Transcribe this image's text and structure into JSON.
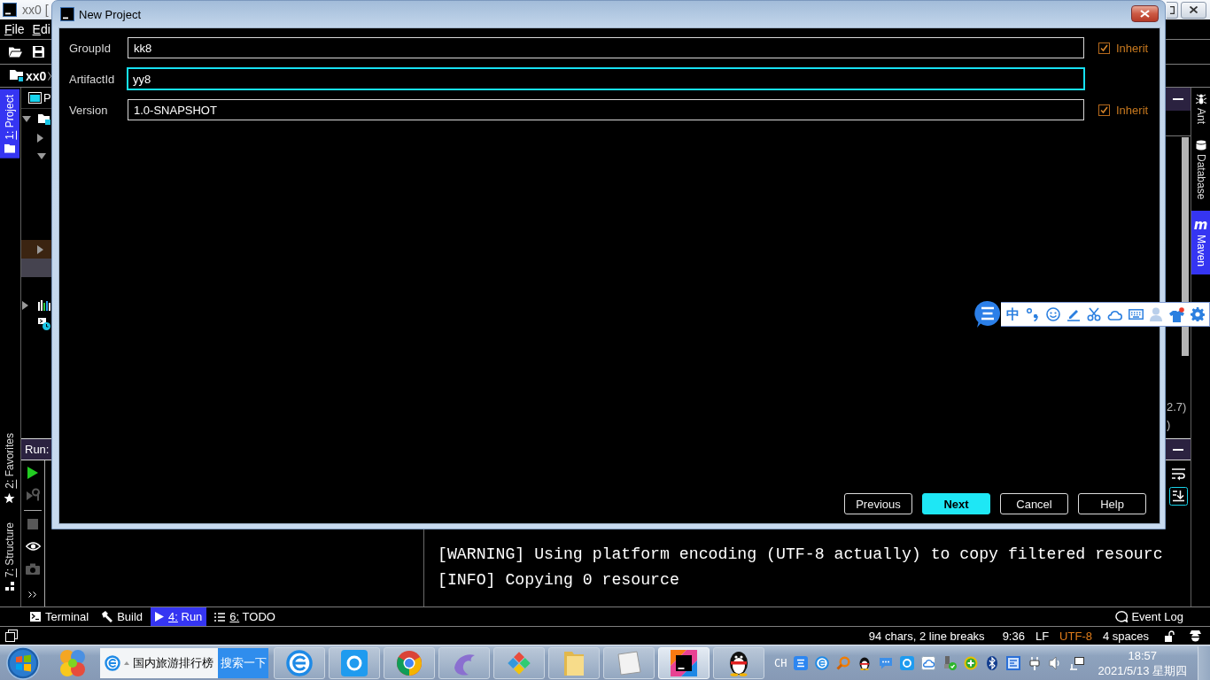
{
  "ide": {
    "title": "xx0 [",
    "menu": [
      {
        "label": "File",
        "mnemonic": true
      },
      {
        "label": "Edi",
        "mnemonic": true
      }
    ],
    "breadcrumb": "xx0",
    "left_tabs": [
      {
        "label": "1: Project",
        "mnemonic": true,
        "selected": true
      },
      {
        "label": "2: Favorites",
        "mnemonic": true,
        "selected": false
      },
      {
        "label": "7: Structure",
        "mnemonic": true,
        "selected": false
      }
    ],
    "project_panel": {
      "title": "P",
      "tree": [
        {
          "kind": "node",
          "expanded": true,
          "selected": false,
          "children": [
            {
              "kind": "node",
              "expanded": false,
              "selected": false
            },
            {
              "kind": "node",
              "expanded": true,
              "selected": false
            },
            {
              "kind": "node",
              "expanded": false,
              "selected": false,
              "color": "#3b2411"
            },
            {
              "kind": "leaf",
              "selected": true
            }
          ]
        },
        {
          "kind": "node",
          "expanded": false,
          "selected": false
        },
        {
          "kind": "leaf",
          "selected": false
        }
      ]
    },
    "run_panel": {
      "title": "Run:",
      "toolbar": [
        {
          "disabled": false
        },
        {
          "disabled": true
        },
        {
          "disabled": true
        },
        {
          "disabled": false
        },
        {
          "disabled": true
        },
        {
          "disabled": false
        }
      ],
      "console": [
        "[WARNING] Using platform encoding (UTF-8 actually) to copy filtered resourc",
        "[INFO] Copying 0 resource"
      ]
    },
    "side_panel_text": [
      "2.7)",
      ")"
    ],
    "right_tabs": [
      {
        "label": "Ant",
        "selected": false
      },
      {
        "label": "Database",
        "selected": false
      },
      {
        "label": "Maven",
        "glyph": "m",
        "selected": true
      }
    ],
    "tool_tabs": [
      {
        "label": "Terminal",
        "mnemonic": false,
        "selected": false
      },
      {
        "label": "Build",
        "mnemonic": false,
        "selected": false
      },
      {
        "label": "4: Run",
        "mnemonic": true,
        "selected": true
      },
      {
        "label": "6: TODO",
        "mnemonic": true,
        "selected": false
      }
    ],
    "event_log": "Event Log",
    "status": [
      {
        "text": "94 chars, 2 line breaks",
        "color": "#ffffff"
      },
      {
        "text": "9:36",
        "color": "#ffffff"
      },
      {
        "text": "LF",
        "color": "#ffffff"
      },
      {
        "text": "UTF-8",
        "color": "#e07c1a"
      },
      {
        "text": "4 spaces",
        "color": "#ffffff"
      }
    ]
  },
  "dialog": {
    "title": "New Project",
    "fields": [
      {
        "label": "GroupId",
        "value": "kk8",
        "focused": false,
        "inherit": {
          "label": "Inherit",
          "checked": true
        }
      },
      {
        "label": "ArtifactId",
        "value": "yy8",
        "focused": true
      },
      {
        "label": "Version",
        "value": "1.0-SNAPSHOT",
        "focused": false,
        "inherit": {
          "label": "Inherit",
          "checked": true
        }
      }
    ],
    "buttons": [
      {
        "label": "Previous",
        "default": false
      },
      {
        "label": "Next",
        "default": true
      },
      {
        "label": "Cancel",
        "default": false
      },
      {
        "label": "Help",
        "default": false
      }
    ]
  },
  "ime_bar": {
    "mode": "中"
  },
  "taskbar": {
    "search": {
      "value": "国内旅游排行榜",
      "button": "搜索一下"
    },
    "apps": [
      {
        "selected": false
      },
      {
        "selected": false
      },
      {
        "selected": false
      },
      {
        "selected": false
      },
      {
        "selected": false
      },
      {
        "selected": false
      },
      {
        "selected": false
      },
      {
        "selected": true
      },
      {
        "selected": false
      }
    ],
    "tray": {
      "language": "CH",
      "time": "18:57",
      "date": "2021/5/13 星期四"
    }
  }
}
